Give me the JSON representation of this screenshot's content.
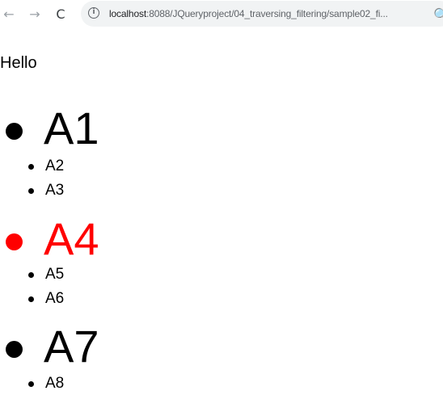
{
  "browser": {
    "back_icon": "←",
    "forward_icon": "→",
    "reload_icon": "C",
    "info_icon": "i",
    "url_host": "localhost",
    "url_path": ":8088/JQueryproject/04_traversing_filtering/sample02_fi...",
    "zoom_icon": "🔍"
  },
  "page": {
    "heading": "Hello",
    "items": [
      {
        "label": "A1",
        "level": "large",
        "color": "#000000"
      },
      {
        "label": "A2",
        "level": "small",
        "color": "#000000"
      },
      {
        "label": "A3",
        "level": "small",
        "color": "#000000"
      },
      {
        "label": "A4",
        "level": "large",
        "color": "#ff0000"
      },
      {
        "label": "A5",
        "level": "small",
        "color": "#000000"
      },
      {
        "label": "A6",
        "level": "small",
        "color": "#000000"
      },
      {
        "label": "A7",
        "level": "large",
        "color": "#000000"
      },
      {
        "label": "A8",
        "level": "small",
        "color": "#000000"
      }
    ]
  }
}
